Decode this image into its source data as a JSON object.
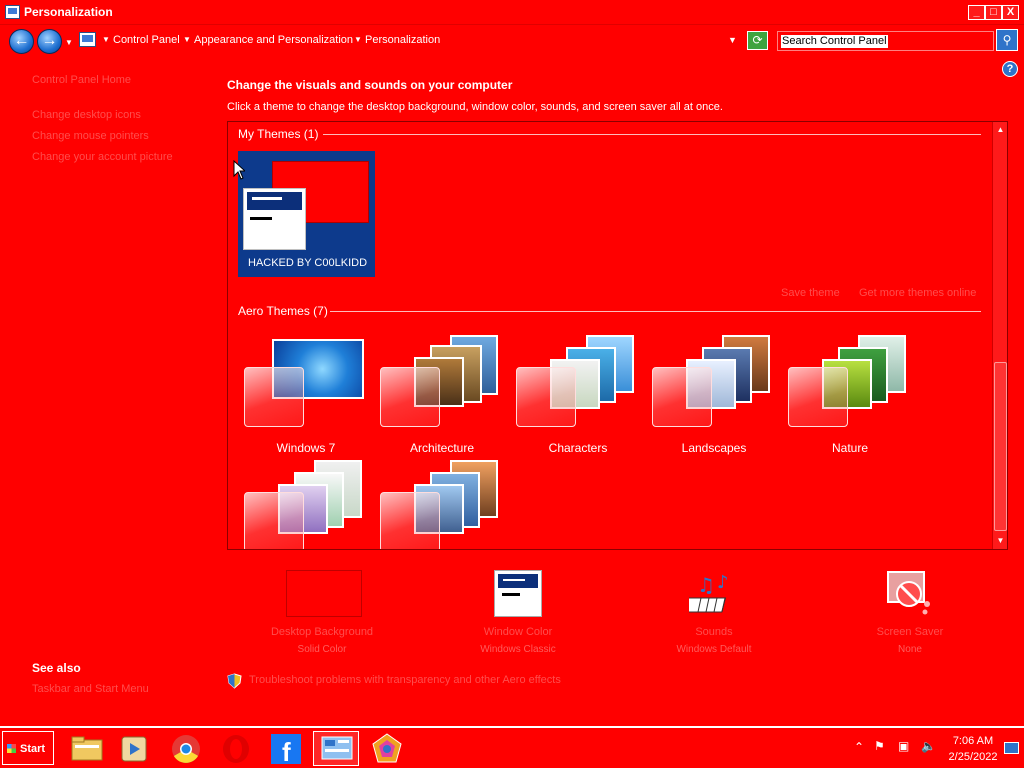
{
  "window": {
    "title": "Personalization",
    "minimize_label": "_",
    "maximize_label": "□",
    "close_label": "X"
  },
  "addressbar": {
    "back_label": "←",
    "forward_label": "→",
    "crumbs": [
      "Control Panel",
      "Appearance and Personalization",
      "Personalization"
    ],
    "search_placeholder": "Search Control Panel"
  },
  "help_label": "?",
  "left_panel": {
    "home_link": "Control Panel Home",
    "links": [
      "Change desktop icons",
      "Change mouse pointers",
      "Change your account picture"
    ],
    "see_also_heading": "See also",
    "see_also_links": [
      "Taskbar and Start Menu"
    ]
  },
  "main": {
    "heading": "Change the visuals and sounds on your computer",
    "subheading": "Click a theme to change the desktop background, window color, sounds, and screen saver all at once.",
    "my_themes_label": "My Themes (1)",
    "my_theme_name": "HACKED BY C00LKIDD",
    "save_theme_link": "Save theme",
    "get_more_link": "Get more themes online",
    "aero_themes_label": "Aero Themes (7)",
    "aero_themes": [
      {
        "name": "Windows 7"
      },
      {
        "name": "Architecture"
      },
      {
        "name": "Characters"
      },
      {
        "name": "Landscapes"
      },
      {
        "name": "Nature"
      },
      {
        "name": ""
      },
      {
        "name": ""
      }
    ]
  },
  "bottom_bar": {
    "items": [
      {
        "label": "Desktop Background",
        "sub": "Solid Color",
        "icon": "desktop-background-icon"
      },
      {
        "label": "Window Color",
        "sub": "Windows Classic",
        "icon": "window-color-icon"
      },
      {
        "label": "Sounds",
        "sub": "Windows Default",
        "icon": "sounds-icon"
      },
      {
        "label": "Screen Saver",
        "sub": "None",
        "icon": "screen-saver-icon"
      }
    ],
    "troubleshoot_link": "Troubleshoot problems with transparency and other Aero effects"
  },
  "taskbar": {
    "start_label": "Start",
    "pinned": [
      "explorer-icon",
      "media-player-icon",
      "chrome-icon",
      "opera-icon",
      "facebook-icon",
      "control-panel-icon",
      "paint-icon"
    ],
    "clock_time": "7:06 AM",
    "clock_date": "2/25/2022"
  },
  "colors": {
    "background": "#ff0000",
    "text": "#ffffff",
    "link": "#ff4d4d",
    "accent_blue": "#2f73c9"
  }
}
